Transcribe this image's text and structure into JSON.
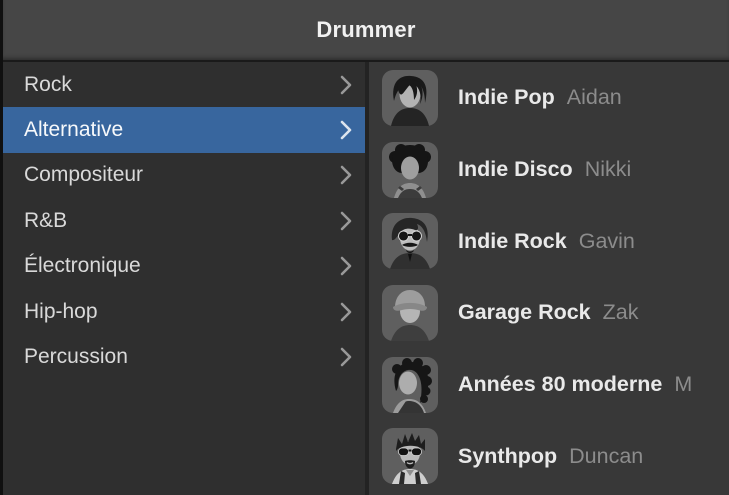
{
  "header": {
    "title": "Drummer"
  },
  "sidebar": {
    "items": [
      {
        "label": "Rock",
        "selected": false
      },
      {
        "label": "Alternative",
        "selected": true
      },
      {
        "label": "Compositeur",
        "selected": false
      },
      {
        "label": "R&B",
        "selected": false
      },
      {
        "label": "Électronique",
        "selected": false
      },
      {
        "label": "Hip-hop",
        "selected": false
      },
      {
        "label": "Percussion",
        "selected": false
      }
    ]
  },
  "drummers": {
    "items": [
      {
        "style": "Indie Pop",
        "name": "Aidan"
      },
      {
        "style": "Indie Disco",
        "name": "Nikki"
      },
      {
        "style": "Indie Rock",
        "name": "Gavin"
      },
      {
        "style": "Garage Rock",
        "name": "Zak"
      },
      {
        "style": "Années 80 moderne",
        "name": "M"
      },
      {
        "style": "Synthpop",
        "name": "Duncan"
      }
    ]
  },
  "colors": {
    "selection_blue": "#38669e",
    "header_bg": "#464646",
    "sidebar_bg": "#2f2f2f",
    "panel_bg": "#383838",
    "avatar_tile": "#5f5f5f",
    "primary_text": "#e9e9e9",
    "secondary_text": "#8c8c8c"
  }
}
